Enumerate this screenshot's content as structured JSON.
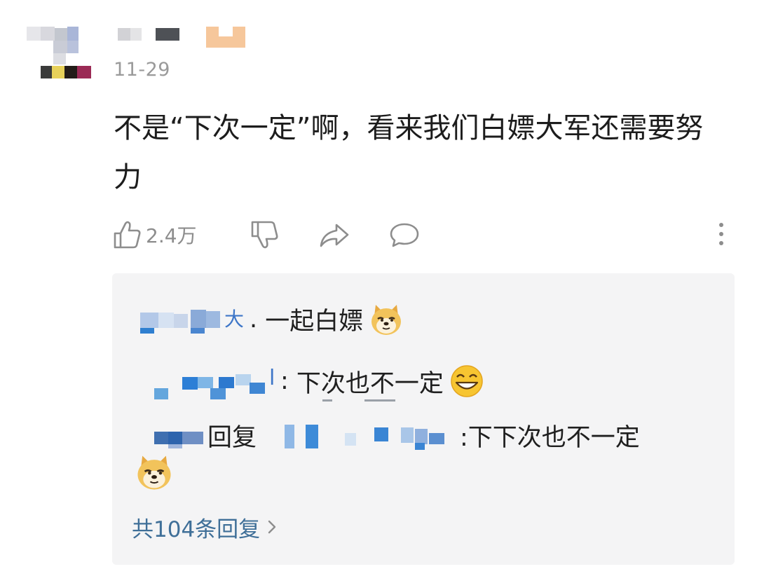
{
  "comment": {
    "date": "11-29",
    "text_line1": "不是“下次一定”啊，看来我们白嫖大军还需要努",
    "text_line2": "力",
    "like_count": "2.4万"
  },
  "replies": [
    {
      "author_tail": "大",
      "text": "一起白嫖",
      "emoji": "doge-emoji"
    },
    {
      "author_tail": "l",
      "text": "下次也不一定",
      "emoji": "squint-smile-emoji"
    },
    {
      "reply_word": "回复",
      "text": ":下下次也不一定",
      "emoji": "doge-emoji"
    }
  ],
  "more_replies_label": "共104条回复",
  "colors": {
    "link": "#3f6f98",
    "panel_bg": "#f4f4f5",
    "meta_gray": "#9a9a9a"
  },
  "icons": [
    "thumbs-up-icon",
    "thumbs-down-icon",
    "share-icon",
    "comment-icon",
    "more-vertical-icon",
    "chevron-right-icon"
  ]
}
